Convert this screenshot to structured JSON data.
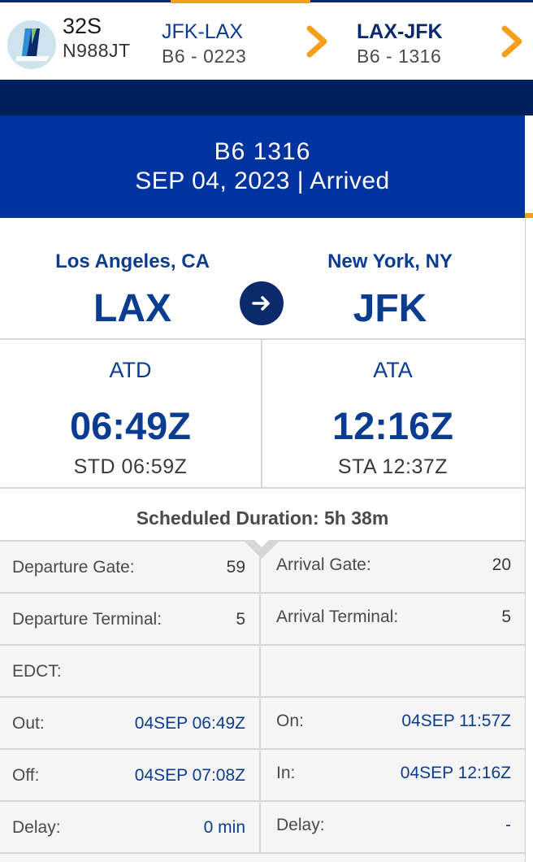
{
  "header": {
    "aircraft_type": "32S",
    "tail_number": "N988JT",
    "legs": [
      {
        "route": "JFK-LAX",
        "flight": "B6 - 0223"
      },
      {
        "route": "LAX-JFK",
        "flight": "B6 - 1316"
      }
    ],
    "icons": {
      "logo": "airline-tail-logo",
      "next": "chevron-right-icon"
    },
    "colors": {
      "accent": "#f5a01a",
      "brand_navy": "#00205b",
      "brand_blue": "#0033a0",
      "link": "#0a3d91"
    }
  },
  "flight": {
    "number": "B6 1316",
    "date_status": "SEP 04, 2023 | Arrived"
  },
  "route": {
    "from_city": "Los Angeles, CA",
    "from_code": "LAX",
    "to_city": "New York, NY",
    "to_code": "JFK",
    "icon": "arrow-right-circle-icon"
  },
  "times": {
    "departure": {
      "label": "ATD",
      "value": "06:49Z",
      "scheduled": "STD 06:59Z"
    },
    "arrival": {
      "label": "ATA",
      "value": "12:16Z",
      "scheduled": "STA 12:37Z"
    }
  },
  "duration": "Scheduled Duration: 5h 38m",
  "details": [
    {
      "left": {
        "label": "Departure Gate:",
        "value": "59"
      },
      "right": {
        "label": "Arrival Gate:",
        "value": "20"
      }
    },
    {
      "left": {
        "label": "Departure Terminal:",
        "value": "5"
      },
      "right": {
        "label": "Arrival Terminal:",
        "value": "5"
      }
    },
    {
      "left": {
        "label": "EDCT:",
        "value": ""
      },
      "right": {
        "label": "",
        "value": ""
      }
    },
    {
      "left": {
        "label": "Out:",
        "value": "04SEP 06:49Z"
      },
      "right": {
        "label": "On:",
        "value": "04SEP 11:57Z"
      }
    },
    {
      "left": {
        "label": "Off:",
        "value": "04SEP 07:08Z"
      },
      "right": {
        "label": "In:",
        "value": "04SEP 12:16Z"
      }
    },
    {
      "left": {
        "label": "Delay:",
        "value": "0 min"
      },
      "right": {
        "label": "Delay:",
        "value": "-"
      }
    }
  ]
}
